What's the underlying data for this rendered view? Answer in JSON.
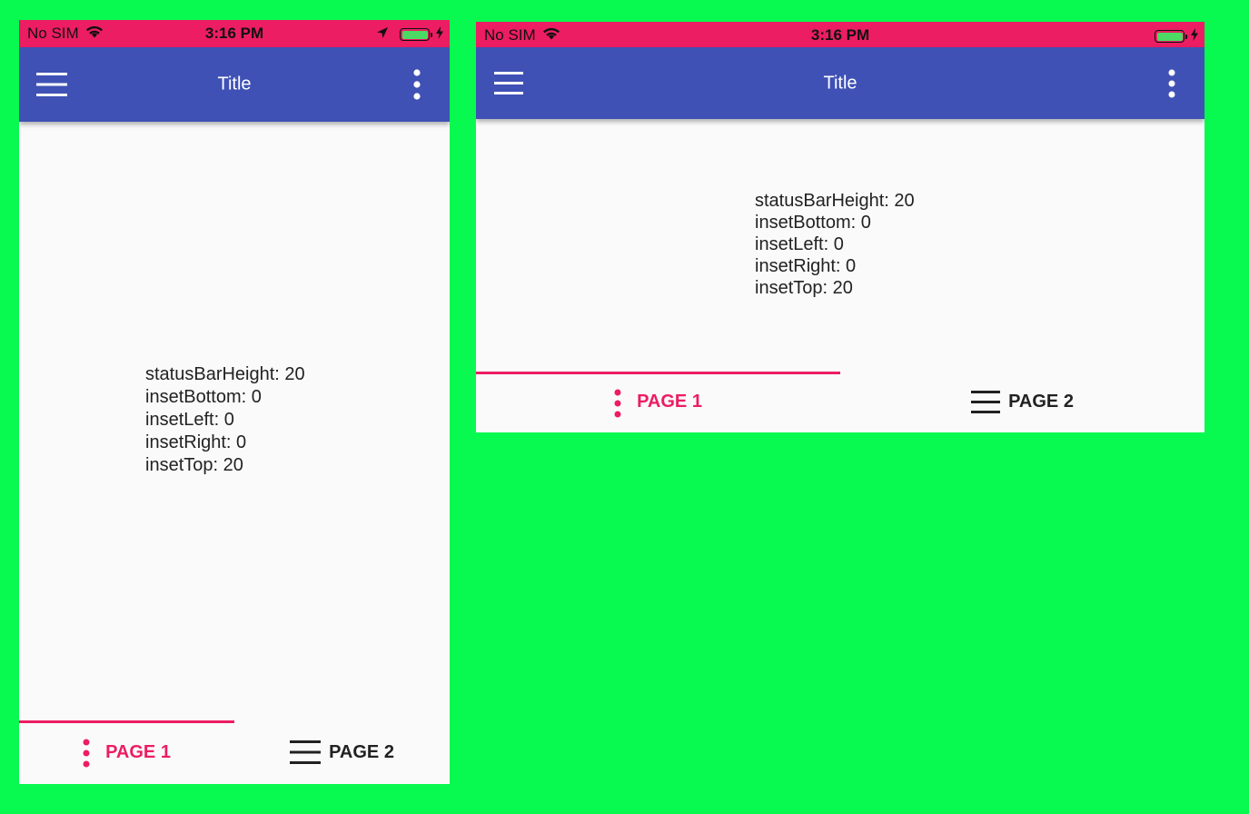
{
  "status_bar": {
    "carrier": "No SIM",
    "time": "3:16 PM"
  },
  "app_bar": {
    "title": "Title",
    "menu_icon": "hamburger-menu-icon",
    "more_icon": "more-vert-icon"
  },
  "insets": [
    "statusBarHeight: 20",
    "insetBottom: 0",
    "insetLeft: 0",
    "insetRight: 0",
    "insetTop: 20"
  ],
  "tabs": [
    {
      "label": "PAGE 1",
      "icon": "more-vert-icon",
      "selected": true
    },
    {
      "label": "PAGE 2",
      "icon": "menu-icon",
      "selected": false
    }
  ],
  "colors": {
    "background": "#08F950",
    "status_bar": "#EC1D62",
    "app_bar": "#3F51B5",
    "accent": "#EC1D62",
    "surface": "#FAFAFA",
    "battery": "#4CD964"
  }
}
